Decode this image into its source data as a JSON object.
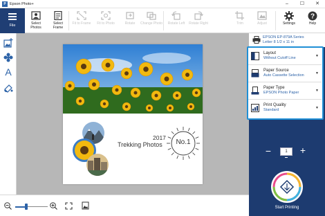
{
  "window": {
    "title": "Epson Photo+",
    "app_icon": "photo-app-icon",
    "minimize": "–",
    "maximize": "☐",
    "close": "✕"
  },
  "toolbar": {
    "file_label": "File",
    "items": [
      {
        "label": "Select\nPhotos",
        "icon": "select-photos-icon",
        "enabled": true
      },
      {
        "label": "Select\nFrame",
        "icon": "select-frame-icon",
        "enabled": true
      },
      {
        "label": "Fit to Frame",
        "icon": "fit-frame-icon",
        "enabled": false
      },
      {
        "label": "Fit to Photo",
        "icon": "fit-photo-icon",
        "enabled": false
      },
      {
        "label": "Rotate",
        "icon": "rotate-icon",
        "enabled": false
      },
      {
        "label": "Change Photo",
        "icon": "change-photo-icon",
        "enabled": false
      },
      {
        "label": "Rotate Left",
        "icon": "rotate-left-icon",
        "enabled": false
      },
      {
        "label": "Rotate Right",
        "icon": "rotate-right-icon",
        "enabled": false
      },
      {
        "label": "Trim",
        "icon": "crop-icon",
        "enabled": false
      },
      {
        "label": "Adjust",
        "icon": "adjust-icon",
        "enabled": false
      }
    ],
    "settings_label": "Settings",
    "help_label": "Help"
  },
  "left_tools": [
    {
      "icon": "add-image-icon"
    },
    {
      "icon": "stamp-icon"
    },
    {
      "icon": "text-icon",
      "glyph": "A"
    },
    {
      "icon": "background-color-icon"
    }
  ],
  "canvas": {
    "year_text": "2017",
    "title_text": "Trekking Photos",
    "badge_text": "No.1"
  },
  "printer": {
    "name": "EPSON EP-879A Series",
    "paper_size": "Letter 8 1/2 x 11 in"
  },
  "print_settings": [
    {
      "name": "Layout",
      "value": "Without Cutoff Line",
      "icon": "layout-icon"
    },
    {
      "name": "Paper Source",
      "value": "Auto Cassette Selection",
      "icon": "paper-source-icon"
    },
    {
      "name": "Paper Type",
      "value": "EPSON Photo Paper",
      "icon": "paper-type-icon"
    },
    {
      "name": "Print Quality",
      "value": "Standard",
      "icon": "print-quality-icon"
    }
  ],
  "copies": {
    "value": "1",
    "minus": "−",
    "plus": "+"
  },
  "start_printing_label": "Start Printing",
  "zoom": {
    "level": 0.35
  }
}
